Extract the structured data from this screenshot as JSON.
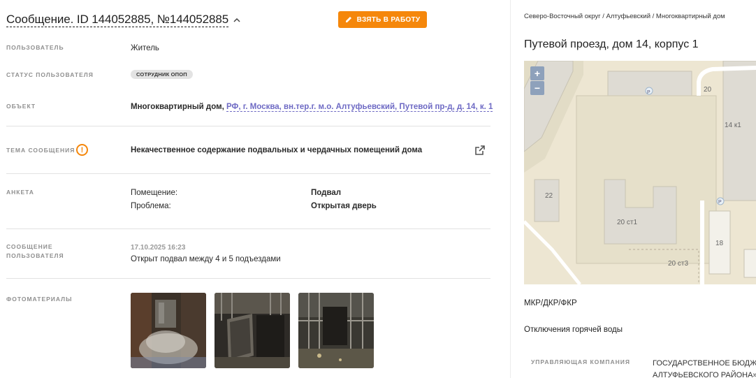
{
  "header": {
    "title": "Сообщение. ID 144052885, №144052885",
    "take_button": "ВЗЯТЬ В РАБОТУ"
  },
  "fields": {
    "user_label": "ПОЛЬЗОВАТЕЛЬ",
    "user_value": "Житель",
    "status_label": "СТАТУС ПОЛЬЗОВАТЕЛЯ",
    "status_value": "СОТРУДНИК ОПОП",
    "object_label": "ОБЪЕКТ",
    "object_prefix": "Многоквартирный дом,",
    "object_link": "РФ, г. Москва, вн.тер.г. м.о. Алтуфьевский, Путевой пр-д, д. 14, к. 1",
    "topic_label": "ТЕМА СООБЩЕНИЯ",
    "topic_value": "Некачественное содержание подвальных и чердачных помещений дома",
    "form_label": "АНКЕТА",
    "form_rows": [
      {
        "key": "Помещение:",
        "value": "Подвал"
      },
      {
        "key": "Проблема:",
        "value": "Открытая дверь"
      }
    ],
    "message_label_1": "СООБЩЕНИЕ",
    "message_label_2": "ПОЛЬЗОВАТЕЛЯ",
    "message_date": "17.10.2025 16:23",
    "message_text": "Открыт подвал между 4 и 5 подъездами",
    "photos_label": "ФОТОМАТЕРИАЛЫ"
  },
  "right": {
    "breadcrumb": "Северо-Восточный округ / Алтуфьевский / Многоквартирный дом",
    "address": "Путевой проезд, дом 14, корпус 1",
    "map": {
      "zoom_in": "+",
      "zoom_out": "−",
      "labels": [
        "20",
        "14 к1",
        "22",
        "20 ст1",
        "18",
        "20 ст3",
        "P",
        "P"
      ]
    },
    "item1": "МКР/ДКР/ФКР",
    "item2": "Отключения горячей воды",
    "company_label": "УПРАВЛЯЮЩАЯ КОМПАНИЯ",
    "company_value_1": "ГОСУДАРСТВЕННОЕ БЮДЖЕТ",
    "company_value_2": "АЛТУФЬЕВСКОГО РАЙОНА»"
  },
  "colors": {
    "accent": "#f5870b",
    "link": "#6e6ac4",
    "map_bg": "#ede6d2"
  }
}
